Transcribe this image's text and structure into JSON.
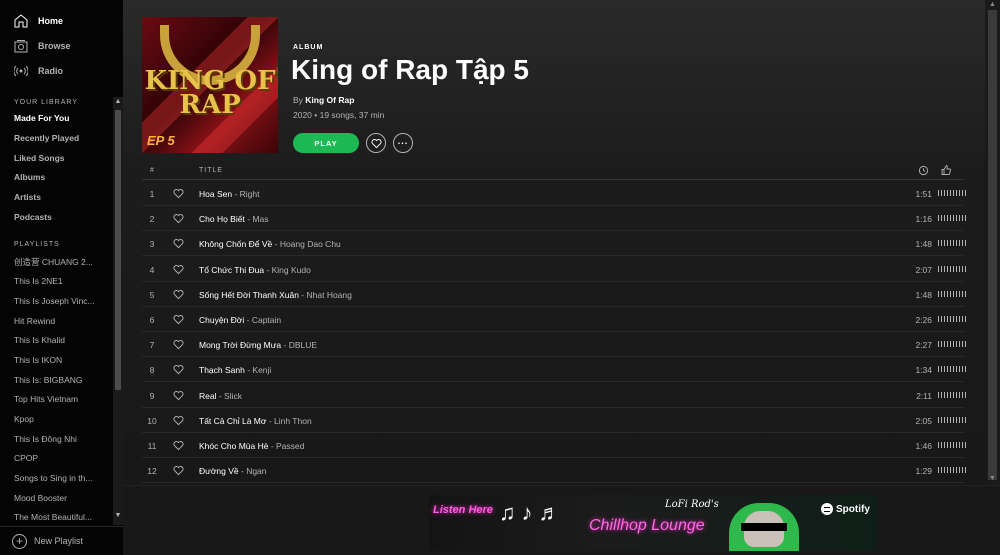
{
  "sidebar": {
    "nav": [
      {
        "label": "Home",
        "icon": "home-icon"
      },
      {
        "label": "Browse",
        "icon": "browse-icon"
      },
      {
        "label": "Radio",
        "icon": "radio-icon"
      }
    ],
    "library_label": "YOUR LIBRARY",
    "library": [
      "Made For You",
      "Recently Played",
      "Liked Songs",
      "Albums",
      "Artists",
      "Podcasts"
    ],
    "playlists_label": "PLAYLISTS",
    "playlists": [
      "创造营 CHUANG 2...",
      "This Is 2NE1",
      "This Is Joseph Vinc...",
      "Hit Rewind",
      "This Is Khalid",
      "This Is IKON",
      "This Is: BIGBANG",
      "Top Hits Vietnam",
      "Kpop",
      "This Is Đông Nhi",
      "CPOP",
      "Songs to Sing in th...",
      "Mood Booster",
      "The Most Beautiful..."
    ],
    "new_playlist": "New Playlist"
  },
  "album": {
    "label": "ALBUM",
    "title": "King of Rap Tập 5",
    "by": "By",
    "artist": "King Of Rap",
    "meta": "2020 • 19 songs, 37 min",
    "play": "PLAY",
    "cover_text": "KING OF RAP",
    "cover_ep": "EP 5"
  },
  "table": {
    "num_header": "#",
    "title_header": "TITLE",
    "tracks": [
      {
        "n": "1",
        "title": "Hoa Sen",
        "artist": "Right",
        "dur": "1:51",
        "pop": 1
      },
      {
        "n": "2",
        "title": "Cho Họ Biết",
        "artist": "Mas",
        "dur": "1:16",
        "pop": 1
      },
      {
        "n": "3",
        "title": "Không Chốn Để Về",
        "artist": "Hoang Dao Chu",
        "dur": "1:48",
        "pop": 1
      },
      {
        "n": "4",
        "title": "Tổ Chức Thi Đua",
        "artist": "King Kudo",
        "dur": "2:07",
        "pop": 1
      },
      {
        "n": "5",
        "title": "Sống Hết Đời Thanh Xuân",
        "artist": "Nhat Hoang",
        "dur": "1:48",
        "pop": 1
      },
      {
        "n": "6",
        "title": "Chuyện Đời",
        "artist": "Captain",
        "dur": "2:26",
        "pop": 1
      },
      {
        "n": "7",
        "title": "Mong Trời Đừng Mưa",
        "artist": "DBLUE",
        "dur": "2:27",
        "pop": 1
      },
      {
        "n": "8",
        "title": "Thạch Sanh",
        "artist": "Kenji",
        "dur": "1:34",
        "pop": 1
      },
      {
        "n": "9",
        "title": "Real",
        "artist": "Slick",
        "dur": "2:11",
        "pop": 1
      },
      {
        "n": "10",
        "title": "Tất Cả Chỉ Là Mơ",
        "artist": "Linh Thon",
        "dur": "2:05",
        "pop": 1
      },
      {
        "n": "11",
        "title": "Khóc Cho Mùa Hè",
        "artist": "Passed",
        "dur": "1:46",
        "pop": 1
      },
      {
        "n": "12",
        "title": "Đường Về",
        "artist": "Ngan",
        "dur": "1:29",
        "pop": 1
      }
    ]
  },
  "ad": {
    "listen": "Listen Here",
    "lofi": "LoFi Rod's",
    "chillhop": "Chillhop Lounge",
    "brand": "Spotify"
  },
  "colors": {
    "accent": "#1db954",
    "bg": "#121212",
    "sidebar": "#040404"
  }
}
